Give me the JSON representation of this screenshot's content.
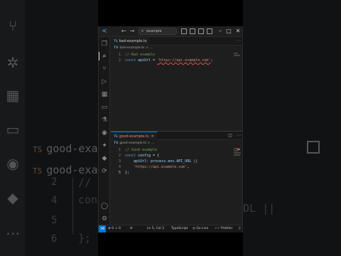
{
  "window": {
    "search_placeholder": "example"
  },
  "editor_top": {
    "tab_label": "bad-example.ts",
    "tab_icon": "TS",
    "breadcrumb": "bad-example.ts > ...",
    "lines": [
      {
        "n": "1",
        "comment": "// Bad example"
      },
      {
        "n": "2",
        "kw": "const",
        "id": "apiUrl",
        "op": " = ",
        "str": "'https://api.example.com'",
        "end": ";"
      }
    ]
  },
  "editor_bottom": {
    "tab_label": "good-example.ts",
    "tab_icon": "TS",
    "breadcrumb": "good-example.ts > ...",
    "lines": [
      {
        "n": "1",
        "comment": "// Good example"
      },
      {
        "n": "2",
        "kw": "const",
        "id": "config",
        "op": " = {"
      },
      {
        "n": "3",
        "prop": "apiUrl",
        "colon": ": ",
        "expr": "process.env.API_URL",
        "or": " ||"
      },
      {
        "n": "4",
        "str": "'https://api.example.com'",
        "end": ","
      },
      {
        "n": "5",
        "end": "};"
      }
    ]
  },
  "status": {
    "errors": "0",
    "warnings": "0",
    "position": "Ln 5, Col 3",
    "language": "TypeScript",
    "golive": "Go Live",
    "prettier": "Prettier"
  },
  "background": {
    "tab1": "good-example",
    "tab2": "good-exa",
    "lines": [
      "2",
      "4",
      "5",
      "6"
    ],
    "line_code_1": "// G",
    "line_code_2": "cons",
    "line_code_3": "};",
    "right_text": "DL ||"
  },
  "colors": {
    "accent": "#0078d4",
    "error": "#f14c4c",
    "ts_icon": "#519aba"
  }
}
